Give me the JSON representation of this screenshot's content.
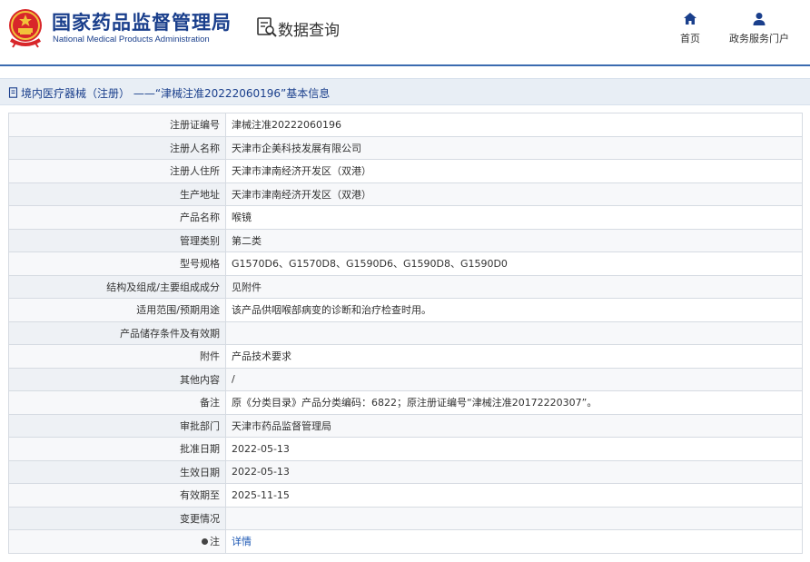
{
  "header": {
    "agency_cn": "国家药品监督管理局",
    "agency_en": "National Medical Products Administration",
    "query_title": "数据查询",
    "nav": [
      {
        "label": "首页",
        "icon": "home-icon"
      },
      {
        "label": "政务服务门户",
        "icon": "user-icon"
      }
    ]
  },
  "breadcrumb": {
    "text": "境内医疗器械（注册） ——“津械注准20222060196”基本信息"
  },
  "fields": [
    {
      "label": "注册证编号",
      "value": "津械注准20222060196"
    },
    {
      "label": "注册人名称",
      "value": "天津市企美科技发展有限公司"
    },
    {
      "label": "注册人住所",
      "value": "天津市津南经济开发区（双港）"
    },
    {
      "label": "生产地址",
      "value": "天津市津南经济开发区（双港）"
    },
    {
      "label": "产品名称",
      "value": "喉镜"
    },
    {
      "label": "管理类别",
      "value": "第二类"
    },
    {
      "label": "型号规格",
      "value": "G1570D6、G1570D8、G1590D6、G1590D8、G1590D0"
    },
    {
      "label": "结构及组成/主要组成成分",
      "value": "见附件"
    },
    {
      "label": "适用范围/预期用途",
      "value": "该产品供咽喉部病变的诊断和治疗检查时用。"
    },
    {
      "label": "产品储存条件及有效期",
      "value": ""
    },
    {
      "label": "附件",
      "value": "产品技术要求"
    },
    {
      "label": "其他内容",
      "value": "/"
    },
    {
      "label": "备注",
      "value": "原《分类目录》产品分类编码：6822；原注册证编号“津械注准20172220307”。"
    },
    {
      "label": "审批部门",
      "value": "天津市药品监督管理局"
    },
    {
      "label": "批准日期",
      "value": "2022-05-13"
    },
    {
      "label": "生效日期",
      "value": "2022-05-13"
    },
    {
      "label": "有效期至",
      "value": "2025-11-15"
    },
    {
      "label": "变更情况",
      "value": ""
    }
  ],
  "note_row": {
    "label": "注",
    "value": "详情"
  },
  "colors": {
    "brand": "#1a3f8c",
    "link": "#1a56b3",
    "header_line": "#3b6bb0",
    "crumb_bg": "#e8eef5"
  }
}
